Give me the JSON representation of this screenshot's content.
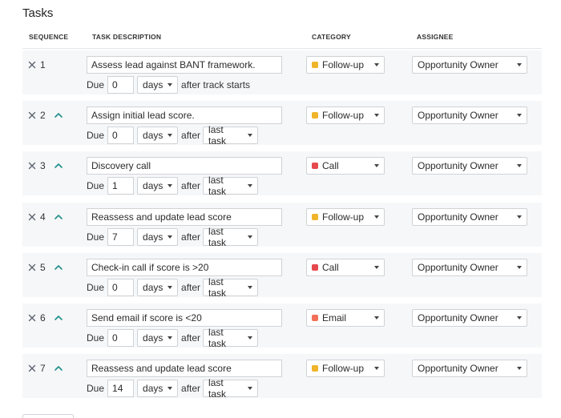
{
  "page_title": "Tasks",
  "columns": {
    "sequence": "SEQUENCE",
    "task_description": "TASK DESCRIPTION",
    "category": "CATEGORY",
    "assignee": "ASSIGNEE"
  },
  "labels": {
    "due": "Due",
    "after": "after"
  },
  "colors": {
    "follow-up": "#f0b429",
    "call": "#e5484d",
    "email": "#f2705a",
    "up_arrow": "#1f8f8a",
    "remove_x": "#5b6470"
  },
  "tasks": [
    {
      "seq": "1",
      "description": "Assess lead against BANT framework.",
      "due_value": "0",
      "due_unit": "days",
      "after_text": "after track starts",
      "relative_to": null,
      "category": "Follow-up",
      "category_key": "follow-up",
      "assignee": "Opportunity Owner",
      "can_move_up": false
    },
    {
      "seq": "2",
      "description": "Assign initial lead score.",
      "due_value": "0",
      "due_unit": "days",
      "after_text": "after",
      "relative_to": "last task",
      "category": "Follow-up",
      "category_key": "follow-up",
      "assignee": "Opportunity Owner",
      "can_move_up": true
    },
    {
      "seq": "3",
      "description": "Discovery call",
      "due_value": "1",
      "due_unit": "days",
      "after_text": "after",
      "relative_to": "last task",
      "category": "Call",
      "category_key": "call",
      "assignee": "Opportunity Owner",
      "can_move_up": true
    },
    {
      "seq": "4",
      "description": "Reassess and update lead score",
      "due_value": "7",
      "due_unit": "days",
      "after_text": "after",
      "relative_to": "last task",
      "category": "Follow-up",
      "category_key": "follow-up",
      "assignee": "Opportunity Owner",
      "can_move_up": true
    },
    {
      "seq": "5",
      "description": "Check-in call if score is >20",
      "due_value": "0",
      "due_unit": "days",
      "after_text": "after",
      "relative_to": "last task",
      "category": "Call",
      "category_key": "call",
      "assignee": "Opportunity Owner",
      "can_move_up": true
    },
    {
      "seq": "6",
      "description": "Send email if score is <20",
      "due_value": "0",
      "due_unit": "days",
      "after_text": "after",
      "relative_to": "last task",
      "category": "Email",
      "category_key": "email",
      "assignee": "Opportunity Owner",
      "can_move_up": true
    },
    {
      "seq": "7",
      "description": "Reassess and update lead score",
      "due_value": "14",
      "due_unit": "days",
      "after_text": "after",
      "relative_to": "last task",
      "category": "Follow-up",
      "category_key": "follow-up",
      "assignee": "Opportunity Owner",
      "can_move_up": true
    }
  ]
}
